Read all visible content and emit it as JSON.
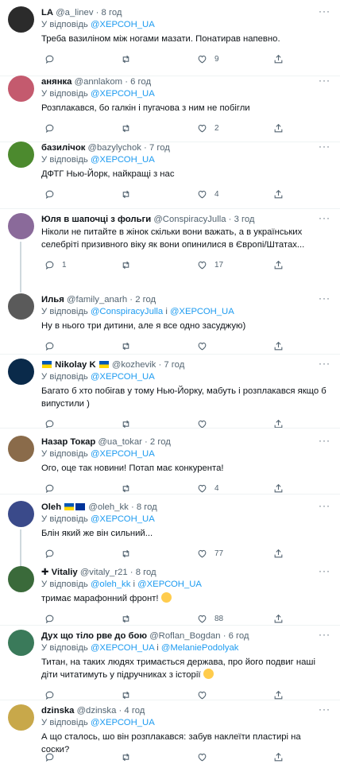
{
  "reply_prefix": "У відповідь",
  "reply_conj": "і",
  "tweets": [
    {
      "name": "LA",
      "handle": "@a_linev",
      "dot": "·",
      "time": "8 год",
      "reply_to": [
        "@ХЕРСОН_UA"
      ],
      "text": "Треба вазиліном між ногами мазати. Понатирав напевно.",
      "replies": "",
      "retweets": "",
      "likes": "9",
      "avatar_color": "#2b2b2b"
    },
    {
      "name": "анянка",
      "handle": "@annlakom",
      "dot": "·",
      "time": "6 год",
      "reply_to": [
        "@ХЕРСОН_UA"
      ],
      "text": "Розплакався, бо галкін і пугачова з ним не побігли",
      "replies": "",
      "retweets": "",
      "likes": "2",
      "avatar_color": "#c45a6e"
    },
    {
      "name": "базилічок",
      "handle": "@bazylychok",
      "dot": "·",
      "time": "7 год",
      "reply_to": [
        "@ХЕРСОН_UA"
      ],
      "text": "ДФТГ Нью-Йорк, найкращі з нас",
      "replies": "",
      "retweets": "",
      "likes": "4",
      "avatar_color": "#4c8a2e"
    },
    {
      "name": "Юля в шапочці з фольги",
      "handle": "@ConspiracyJulla",
      "dot": "·",
      "time": "3 год",
      "reply_to": [],
      "text": "Ніколи не питайте в жінок скільки вони важать, а в українських селебріті призивного віку як вони опинилися в Європі/Штатах...",
      "replies": "1",
      "retweets": "",
      "likes": "17",
      "avatar_color": "#8a6a9a"
    },
    {
      "name": "Илья",
      "handle": "@family_anarh",
      "dot": "·",
      "time": "2 год",
      "reply_to": [
        "@ConspiracyJulla",
        "@ХЕРСОН_UA"
      ],
      "text": "Ну в нього три дитини, але я все одно засуджую)",
      "replies": "",
      "retweets": "",
      "likes": "",
      "avatar_color": "#5a5a5a"
    },
    {
      "name": "Nikolay K",
      "handle": "@kozhevik",
      "dot": "·",
      "time": "7 год",
      "reply_to": [
        "@ХЕРСОН_UA"
      ],
      "text": "Багато б хто побігав у тому Нью-Йорку, мабуть і розплакався якщо б випустили )",
      "replies": "",
      "retweets": "",
      "likes": "",
      "avatar_color": "#0a2a4a"
    },
    {
      "name": "Назар Токар",
      "handle": "@ua_tokar",
      "dot": "·",
      "time": "2 год",
      "reply_to": [
        "@ХЕРСОН_UA"
      ],
      "text": "Ого, оце так новини! Потап має конкурента!",
      "replies": "",
      "retweets": "",
      "likes": "4",
      "avatar_color": "#8a6b4a"
    },
    {
      "name": "Oleh",
      "handle": "@oleh_kk",
      "dot": "·",
      "time": "8 год",
      "reply_to": [
        "@ХЕРСОН_UA"
      ],
      "text": "Блін який же він сильний...",
      "replies": "",
      "retweets": "",
      "likes": "77",
      "avatar_color": "#3a4a8a"
    },
    {
      "name": "Vitaliy",
      "handle": "@vitaly_r21",
      "dot": "·",
      "time": "8 год",
      "reply_to": [
        "@oleh_kk",
        "@ХЕРСОН_UA"
      ],
      "text": "тримає марафонний фронт!",
      "replies": "",
      "retweets": "",
      "likes": "88",
      "avatar_color": "#3a6a3a"
    },
    {
      "name": "Дух що тіло рве до бою",
      "handle": "@Roflan_Bogdan",
      "dot": "·",
      "time": "6 год",
      "reply_to": [
        "@ХЕРСОН_UA",
        "@MelaniePodolyak"
      ],
      "text": "Титан, на таких людях тримається держава, про його подвиг наші діти читатимуть у підручниках з історії",
      "replies": "",
      "retweets": "",
      "likes": "",
      "avatar_color": "#3a7a5a"
    },
    {
      "name": "dzinska",
      "handle": "@dzinska",
      "dot": "·",
      "time": "4 год",
      "reply_to": [
        "@ХЕРСОН_UA"
      ],
      "text": "А що сталось, шо він розплакався: забув наклеїти пластирі на соски?",
      "replies": "",
      "retweets": "",
      "likes": "",
      "avatar_color": "#c8a84a"
    }
  ],
  "more_label": "···"
}
